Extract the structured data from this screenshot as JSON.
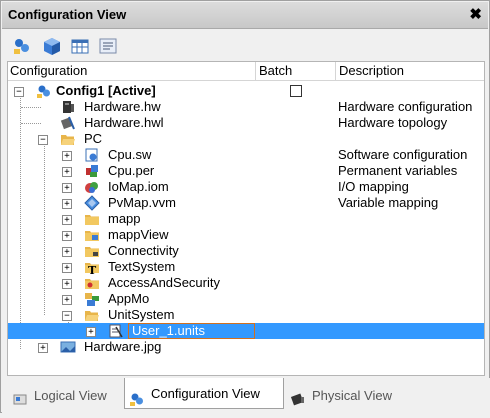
{
  "window": {
    "title": "Configuration View",
    "close_glyph": "✖"
  },
  "toolbar": {
    "buttons": [
      "config-icon",
      "cube-icon",
      "table-icon",
      "list-icon"
    ]
  },
  "columns": {
    "configuration": "Configuration",
    "batch": "Batch",
    "description": "Description"
  },
  "tree": {
    "root": {
      "label": "Config1 [Active]",
      "expander": "−",
      "batch_checked": false
    },
    "hardware_hw": {
      "label": "Hardware.hw",
      "desc": "Hardware configuration"
    },
    "hardware_hwl": {
      "label": "Hardware.hwl",
      "desc": "Hardware topology"
    },
    "pc": {
      "label": "PC",
      "expander": "−"
    },
    "cpu_sw": {
      "label": "Cpu.sw",
      "desc": "Software configuration",
      "expander": "+"
    },
    "cpu_per": {
      "label": "Cpu.per",
      "desc": "Permanent variables",
      "expander": "+"
    },
    "iomap": {
      "label": "IoMap.iom",
      "desc": "I/O mapping",
      "expander": "+"
    },
    "pvmap": {
      "label": "PvMap.vvm",
      "desc": "Variable mapping",
      "expander": "+"
    },
    "mapp": {
      "label": "mapp",
      "expander": "+"
    },
    "mappview": {
      "label": "mappView",
      "expander": "+"
    },
    "connectivity": {
      "label": "Connectivity",
      "expander": "+"
    },
    "textsystem": {
      "label": "TextSystem",
      "expander": "+"
    },
    "accessandsecurity": {
      "label": "AccessAndSecurity",
      "expander": "+"
    },
    "appmo": {
      "label": "AppMo",
      "expander": "+"
    },
    "unitsystem": {
      "label": "UnitSystem",
      "expander": "−"
    },
    "user_units": {
      "label": "User_1.units",
      "expander": "+"
    },
    "hardware_jpg": {
      "label": "Hardware.jpg",
      "expander": "+"
    }
  },
  "tabs": {
    "logical": "Logical View",
    "configuration": "Configuration View",
    "physical": "Physical View"
  },
  "colors": {
    "selection": "#3399ff",
    "edit_border": "#d07020"
  }
}
